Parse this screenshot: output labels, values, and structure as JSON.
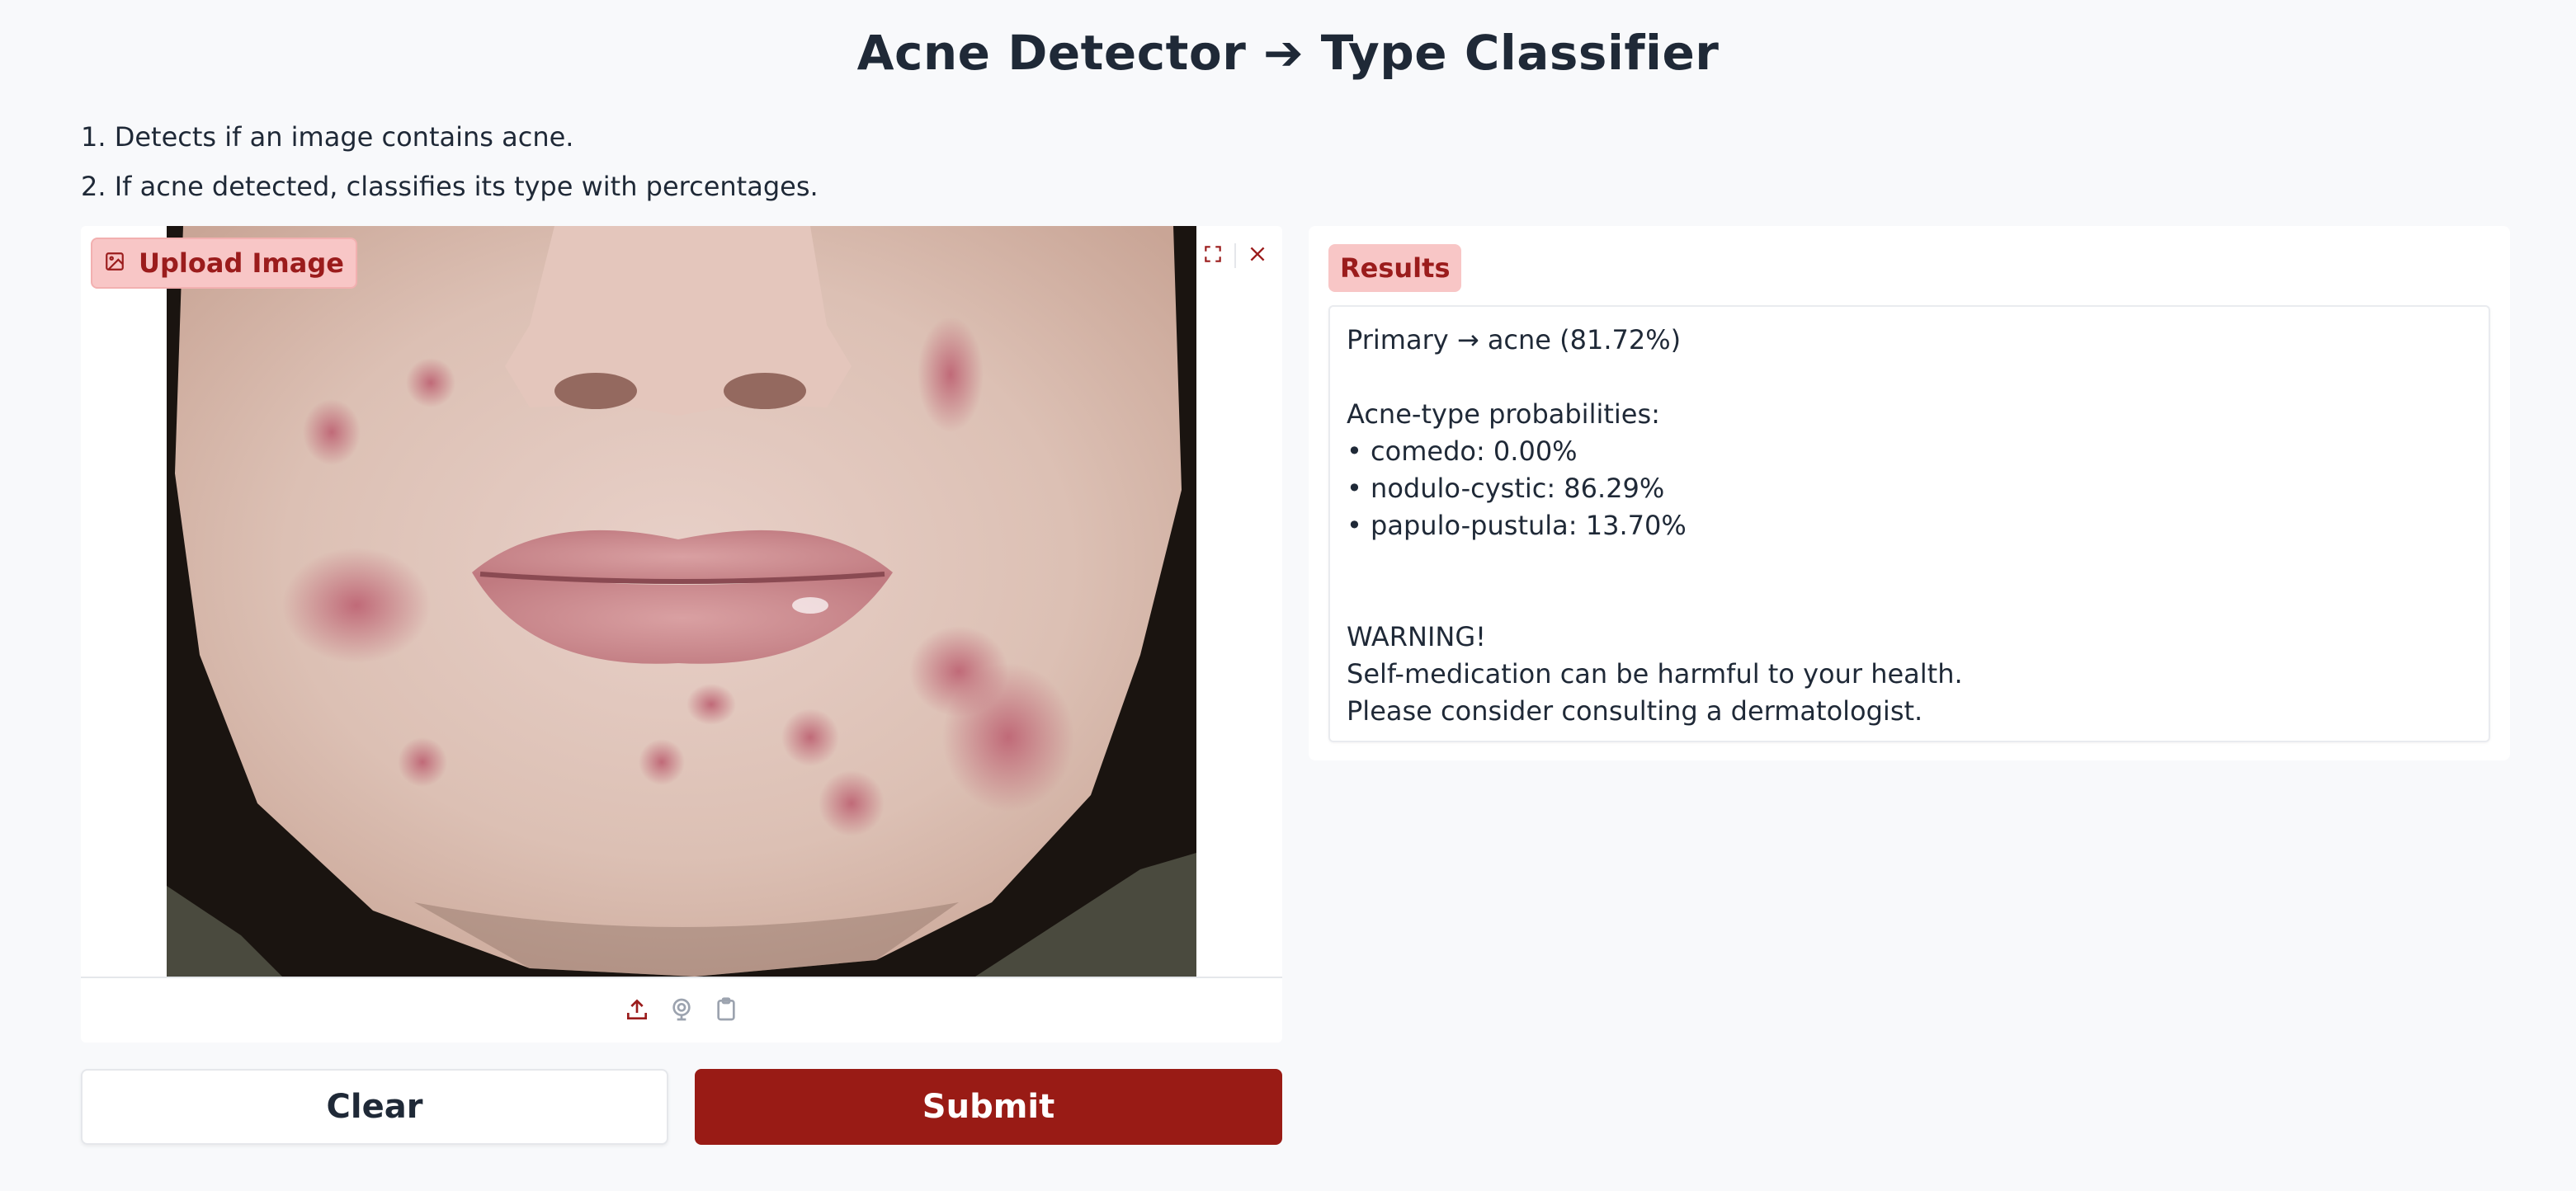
{
  "header": {
    "title": "Acne Detector ➔ Type Classifier"
  },
  "description": {
    "line1": "1. Detects if an image contains acne.",
    "line2": "2. If acne detected, classifies its type with percentages."
  },
  "image_input": {
    "label": "Upload Image",
    "icons": [
      "image-icon",
      "fullscreen-icon",
      "close-icon",
      "upload-icon",
      "webcam-icon",
      "clipboard-icon"
    ]
  },
  "buttons": {
    "clear": "Clear",
    "submit": "Submit"
  },
  "results": {
    "label": "Results",
    "primary": "Primary → acne (81.72%)",
    "probs_header": "Acne-type probabilities:",
    "prob_1": " • comedo: 0.00%",
    "prob_2": " • nodulo-cystic: 86.29%",
    "prob_3": " • papulo-pustula: 13.70%",
    "warning_title": "WARNING!",
    "warning_line1": "Self-medication can be harmful to your health.",
    "warning_line2": "Please consider consulting a dermatologist."
  },
  "colors": {
    "accent": "#991b15",
    "label_bg": "#f8c6c6",
    "label_text": "#9b1c1c",
    "background": "#f8f9fb"
  }
}
